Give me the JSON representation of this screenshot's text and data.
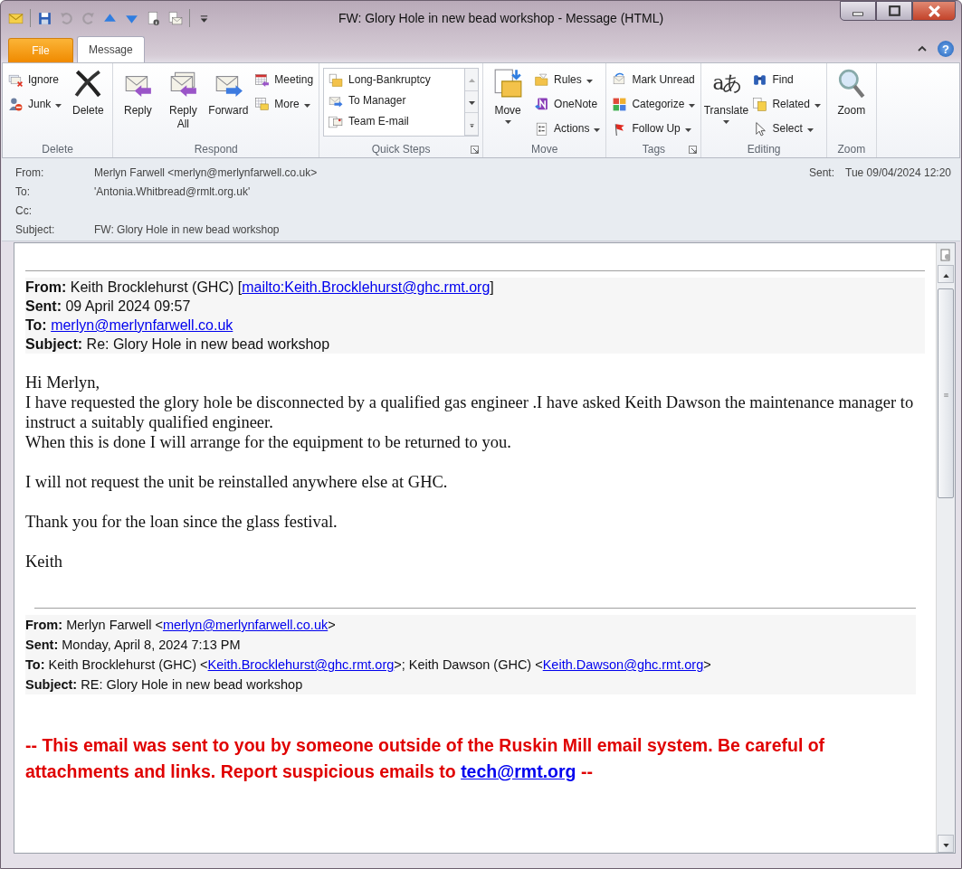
{
  "window": {
    "title": "FW: Glory Hole in new bead workshop  -  Message (HTML)"
  },
  "quick_access": [
    {
      "disabled": false
    },
    {
      "disabled": false
    },
    {
      "disabled": true
    },
    {
      "disabled": true
    },
    {
      "disabled": false
    },
    {
      "disabled": false
    },
    {
      "disabled": false
    },
    {
      "disabled": false
    },
    {
      "disabled": false
    }
  ],
  "tabs": [
    {
      "label": "File",
      "kind": "file",
      "selected": false
    },
    {
      "label": "Message",
      "kind": "tab",
      "selected": true
    }
  ],
  "help": {
    "label": "?"
  },
  "ribbon": {
    "groups": [
      {
        "label": "Delete",
        "launcher": false,
        "items": [
          {
            "kind": "stack",
            "items": [
              {
                "label": "Ignore",
                "dropdown": false
              },
              {
                "label": "Junk",
                "dropdown": true
              }
            ]
          },
          {
            "kind": "large",
            "label": "Delete",
            "dropdown": false
          }
        ]
      },
      {
        "label": "Respond",
        "launcher": false,
        "items": [
          {
            "kind": "large",
            "label": "Reply",
            "dropdown": false
          },
          {
            "kind": "large",
            "label": "Reply All",
            "dropdown": false
          },
          {
            "kind": "large",
            "label": "Forward",
            "dropdown": false
          },
          {
            "kind": "stack",
            "items": [
              {
                "label": "Meeting",
                "dropdown": false
              },
              {
                "label": "More",
                "dropdown": true
              }
            ]
          }
        ]
      },
      {
        "label": "Quick Steps",
        "launcher": true,
        "items": [
          {
            "kind": "gallery",
            "entries": [
              {
                "label": "Long-Bankruptcy"
              },
              {
                "label": "To Manager"
              },
              {
                "label": "Team E-mail"
              }
            ]
          }
        ]
      },
      {
        "label": "Move",
        "launcher": false,
        "items": [
          {
            "kind": "large",
            "label": "Move",
            "dropdown": true
          },
          {
            "kind": "stack",
            "items": [
              {
                "label": "Rules",
                "dropdown": true
              },
              {
                "label": "OneNote",
                "dropdown": false
              },
              {
                "label": "Actions",
                "dropdown": true
              }
            ]
          }
        ]
      },
      {
        "label": "Tags",
        "launcher": true,
        "items": [
          {
            "kind": "stack",
            "items": [
              {
                "label": "Mark Unread",
                "dropdown": false
              },
              {
                "label": "Categorize",
                "dropdown": true
              },
              {
                "label": "Follow Up",
                "dropdown": true
              }
            ]
          }
        ]
      },
      {
        "label": "Editing",
        "launcher": false,
        "items": [
          {
            "kind": "large",
            "label": "Translate",
            "glyphs": "aあ",
            "dropdown": true
          },
          {
            "kind": "stack",
            "items": [
              {
                "label": "Find",
                "dropdown": false
              },
              {
                "label": "Related",
                "dropdown": true
              },
              {
                "label": "Select",
                "dropdown": true
              }
            ]
          }
        ]
      },
      {
        "label": "Zoom",
        "launcher": false,
        "items": [
          {
            "kind": "large",
            "label": "Zoom",
            "dropdown": false
          }
        ]
      }
    ]
  },
  "message_header": {
    "fields": [
      {
        "label": "From:",
        "value": "Merlyn Farwell <merlyn@merlynfarwell.co.uk>"
      },
      {
        "label": "To:",
        "value": "'Antonia.Whitbread@rmlt.org.uk'"
      },
      {
        "label": "Cc:"
      },
      {
        "label": "Subject:",
        "value": "FW: Glory Hole in new bead workshop"
      }
    ],
    "sent": {
      "label": "Sent:",
      "value": "Tue 09/04/2024 12:20"
    }
  },
  "body": [
    {
      "kind": "forward_header",
      "lines": [
        {
          "label": "From:",
          "parts": [
            {
              "text": "Keith Brocklehurst (GHC) ["
            },
            {
              "text": "mailto:Keith.Brocklehurst@ghc.rmt.org",
              "link": true
            },
            {
              "text": "]"
            }
          ]
        },
        {
          "label": "Sent:",
          "parts": [
            {
              "text": "09 April 2024 09:57"
            }
          ]
        },
        {
          "label": "To:",
          "parts": [
            {
              "text": "merlyn@merlynfarwell.co.uk",
              "link": true
            }
          ]
        },
        {
          "label": "Subject:",
          "parts": [
            {
              "text": "Re: Glory Hole in new bead workshop"
            }
          ]
        }
      ]
    },
    {
      "kind": "paragraph",
      "lines": [
        "Hi Merlyn,",
        "I have requested the glory hole be disconnected by a qualified gas engineer .I have asked Keith Dawson the maintenance manager to instruct a suitably qualified engineer.",
        "When this is done I will arrange for the equipment to be returned to you."
      ]
    },
    {
      "kind": "paragraph",
      "lines": [
        "I will not request the unit be reinstalled anywhere else at GHC."
      ]
    },
    {
      "kind": "paragraph",
      "lines": [
        "Thank you for the loan since the glass festival."
      ]
    },
    {
      "kind": "paragraph",
      "lines": [
        "Keith"
      ]
    },
    {
      "kind": "reply_header",
      "lines": [
        {
          "label": "From:",
          "parts": [
            {
              "text": "Merlyn Farwell <"
            },
            {
              "text": "merlyn@merlynfarwell.co.uk",
              "link": true
            },
            {
              "text": ">"
            }
          ]
        },
        {
          "label": "Sent:",
          "parts": [
            {
              "text": "Monday, April 8, 2024 7:13 PM"
            }
          ]
        },
        {
          "label": "To:",
          "parts": [
            {
              "text": "Keith Brocklehurst (GHC) <"
            },
            {
              "text": "Keith.Brocklehurst@ghc.rmt.org",
              "link": true
            },
            {
              "text": ">; Keith Dawson (GHC) <"
            },
            {
              "text": "Keith.Dawson@ghc.rmt.org",
              "link": true
            },
            {
              "text": ">"
            }
          ]
        },
        {
          "label": "Subject:",
          "parts": [
            {
              "text": "RE: Glory Hole in new bead workshop"
            }
          ]
        }
      ]
    },
    {
      "kind": "warning",
      "parts": [
        {
          "text": "-- This email was sent to you by someone outside of the Ruskin Mill email system. Be careful of attachments and links. Report suspicious emails to "
        },
        {
          "text": "tech@rmt.org",
          "link": true
        },
        {
          "text": " --"
        }
      ]
    }
  ]
}
